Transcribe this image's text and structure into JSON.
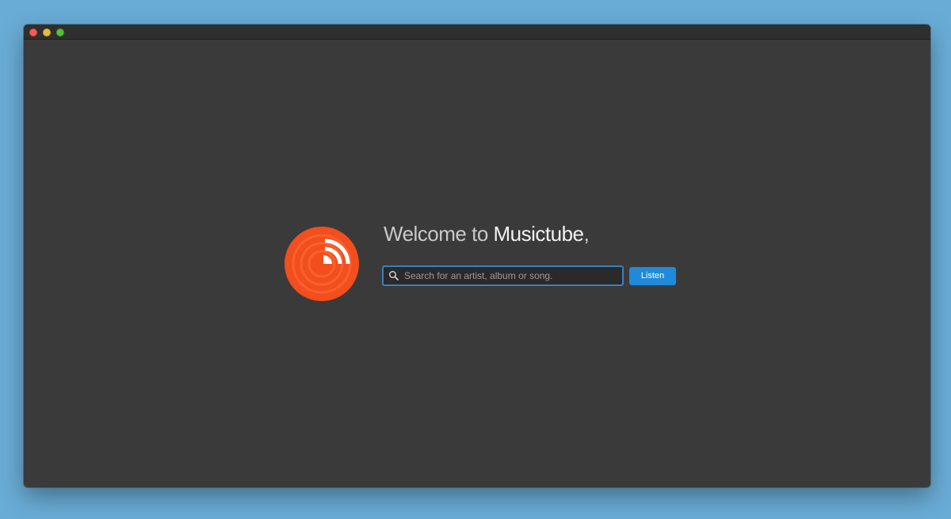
{
  "window": {
    "traffic_lights": [
      "close",
      "minimize",
      "zoom"
    ]
  },
  "welcome": {
    "prefix": "Welcome to ",
    "app_name": "Musictube",
    "suffix": ","
  },
  "search": {
    "placeholder": "Search for an artist, album or song.",
    "value": "",
    "icon": "search-icon"
  },
  "actions": {
    "listen_label": "Listen"
  },
  "logo": {
    "icon": "musictube-logo-icon",
    "color": "#f24e1e"
  },
  "colors": {
    "desktop": "#69acd6",
    "window_bg": "#3a3a3a",
    "accent": "#1f8ad9",
    "search_focus": "#3d7fb8"
  }
}
